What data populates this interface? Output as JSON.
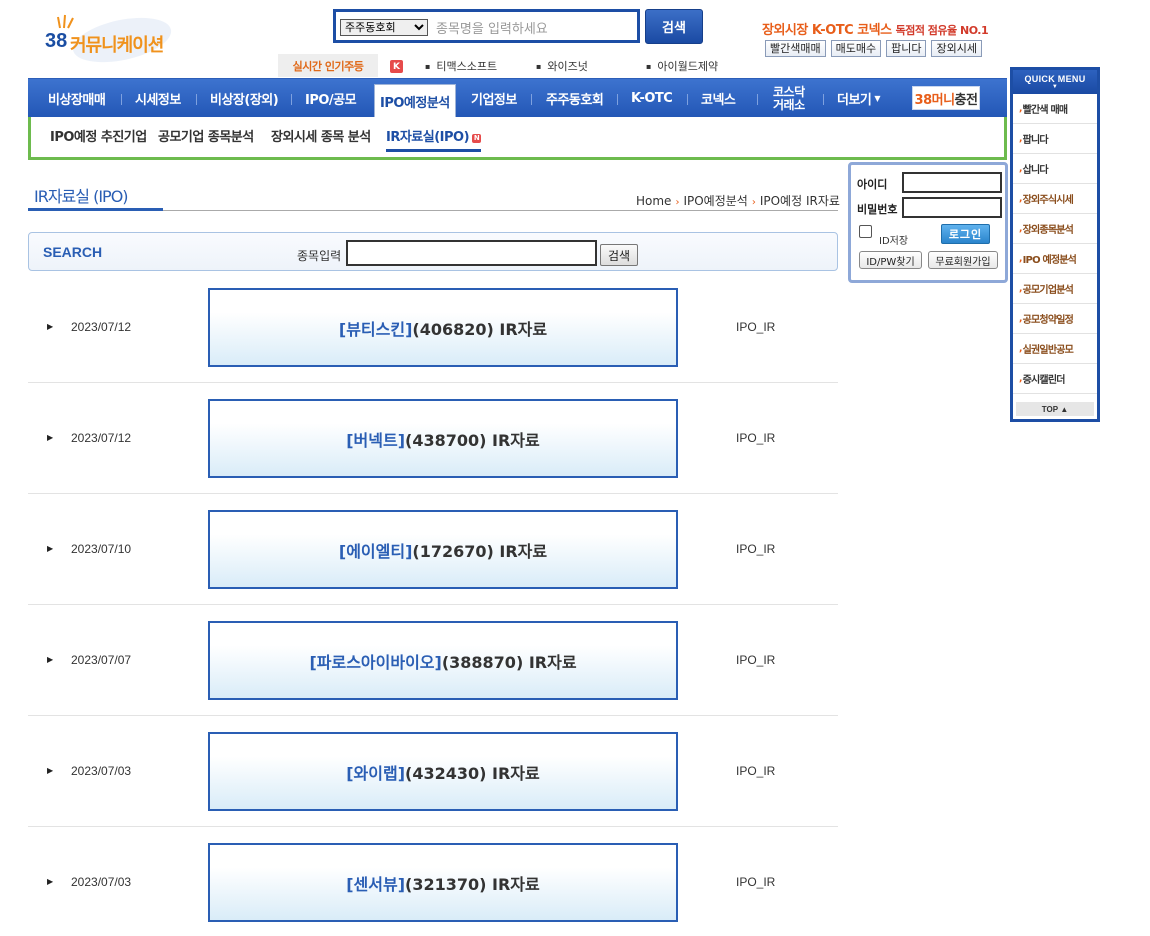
{
  "logo": {
    "number": "38",
    "text": "커뮤니케이션"
  },
  "topsearch": {
    "select_value": "주주동호회",
    "placeholder": "종목명을 입력하세요",
    "button": "검색"
  },
  "promo": {
    "text": "장외시장 K-OTC 코넥스 ",
    "small": "독점적 점유율 NO.1"
  },
  "quick_buttons": [
    "빨간색매매",
    "매도매수",
    "팝니다",
    "장외시세"
  ],
  "popular": {
    "label": "실시간 인기주등",
    "k_icon": "K",
    "items": [
      "티맥스소프트",
      "와이즈넛",
      "아이월드제약"
    ]
  },
  "mainnav": {
    "items": [
      "비상장매매",
      "시세정보",
      "비상장(장외)",
      "IPO/공모",
      "IPO예정분석",
      "기업정보",
      "주주동호회",
      "K-OTC",
      "코넥스"
    ],
    "kosdaq_line1": "코스닥",
    "kosdaq_line2": "거래소",
    "more": "더보기",
    "money_orange": "38머니",
    "money_rest": "충전"
  },
  "subnav": {
    "items": [
      "IPO예정 추진기업",
      "공모기업 종목분석",
      "장외시세 종목 분석",
      "IR자료실(IPO)"
    ],
    "new_badge": "N"
  },
  "page": {
    "title": "IR자료실 (IPO)",
    "breadcrumb": [
      "Home",
      "IPO예정분석",
      "IPO예정 IR자료"
    ]
  },
  "search": {
    "label": "SEARCH",
    "input_label": "종목입력",
    "button": "검색"
  },
  "rows": [
    {
      "date": "2023/07/12",
      "name": "[뷰티스킨]",
      "rest": "(406820) IR자료",
      "category": "IPO_IR"
    },
    {
      "date": "2023/07/12",
      "name": "[버넥트]",
      "rest": "(438700) IR자료",
      "category": "IPO_IR"
    },
    {
      "date": "2023/07/10",
      "name": "[에이엘티]",
      "rest": "(172670) IR자료",
      "category": "IPO_IR"
    },
    {
      "date": "2023/07/07",
      "name": "[파로스아이바이오]",
      "rest": "(388870) IR자료",
      "category": "IPO_IR"
    },
    {
      "date": "2023/07/03",
      "name": "[와이랩]",
      "rest": "(432430) IR자료",
      "category": "IPO_IR"
    },
    {
      "date": "2023/07/03",
      "name": "[센서뷰]",
      "rest": "(321370) IR자료",
      "category": "IPO_IR"
    }
  ],
  "login": {
    "id_label": "아이디",
    "pw_label": "비밀번호",
    "save_label": "ID저장",
    "login_button": "로그인",
    "find_button": "ID/PW찾기",
    "join_button": "무료회원가입"
  },
  "quickmenu": {
    "title": "QUICK MENU",
    "items": [
      "빨간색 매매",
      "팝니다",
      "삽니다",
      "장외주식시세",
      "장외종목분석",
      "IPO 예정분석",
      "공모기업분석",
      "공모청약일정",
      "실권일반공모",
      "증시캘린더"
    ],
    "top": "TOP"
  },
  "colors": {
    "brand_blue": "#1d4ea5",
    "accent_orange": "#e85e1a",
    "subnav_green": "#6dbb4e"
  }
}
